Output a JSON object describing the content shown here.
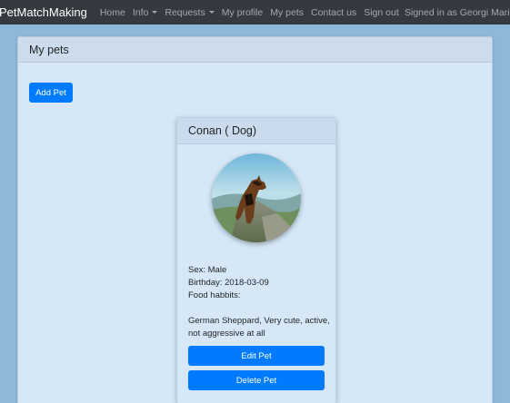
{
  "navbar": {
    "brand": "PetMatchMaking",
    "items": [
      {
        "label": "Home",
        "dropdown": false
      },
      {
        "label": "Info",
        "dropdown": true
      },
      {
        "label": "Requests",
        "dropdown": true
      },
      {
        "label": "My profile",
        "dropdown": false
      },
      {
        "label": "My pets",
        "dropdown": false
      },
      {
        "label": "Contact us",
        "dropdown": false
      },
      {
        "label": "Sign out",
        "dropdown": false
      }
    ],
    "signed_in": "Signed in as Georgi Marinov"
  },
  "page": {
    "title": "My pets",
    "add_button": "Add Pet"
  },
  "pet": {
    "title": "Conan ( Dog)",
    "sex": "Sex: Male",
    "birthday": "Birthday: 2018-03-09",
    "food_label": "Food habbits:",
    "description": "German Sheppard, Very cute, active, not aggressive at all",
    "edit_button": "Edit Pet",
    "delete_button": "Delete Pet",
    "photo_icon": "dog-photo"
  },
  "colors": {
    "navbar": "#343a40",
    "primary": "#007bff",
    "background": "#8db8d9",
    "panel": "#d6e8f8"
  }
}
